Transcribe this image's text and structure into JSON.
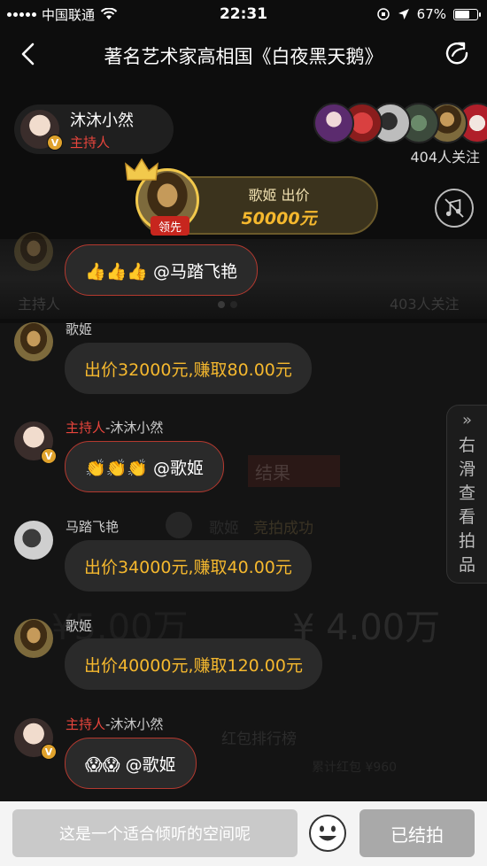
{
  "status_bar": {
    "carrier": "中国联通",
    "time": "22:31",
    "battery": "67%",
    "battery_level": 0.67
  },
  "nav": {
    "title": "著名艺术家高相国《白夜黑天鹅》"
  },
  "host": {
    "name": "沐沐小然",
    "role": "主持人"
  },
  "followers": {
    "count_text": "404人关注"
  },
  "lead_bid": {
    "label": "歌姬 出价",
    "amount": "50000元",
    "tag": "领先"
  },
  "background": {
    "chip_role": "主持人",
    "follow_text": "403人关注",
    "result_title": "结果",
    "winner": "歌姬",
    "winner_status": "竞拍成功",
    "price_left": "¥5.00万",
    "price_right": "¥ 4.00万",
    "ranking": "红包排行榜",
    "total_label": "累计红包 ¥960"
  },
  "messages": [
    {
      "sender": "",
      "role": "",
      "text": "👍👍👍 @马踏飞艳",
      "style": "white"
    },
    {
      "sender": "歌姬",
      "role": "",
      "text": "出价32000元,赚取80.00元",
      "style": "gold"
    },
    {
      "sender": "-沐沐小然",
      "role": "主持人",
      "text": "👏👏👏 @歌姬",
      "style": "host"
    },
    {
      "sender": "马踏飞艳",
      "role": "",
      "text": "出价34000元,赚取40.00元",
      "style": "gold"
    },
    {
      "sender": "歌姬",
      "role": "",
      "text": "出价40000元,赚取120.00元",
      "style": "gold"
    },
    {
      "sender": "-沐沐小然",
      "role": "主持人",
      "text": "😱😱 @歌姬",
      "style": "host"
    }
  ],
  "side_tab": {
    "chevron": "»",
    "label": "右滑查看拍品"
  },
  "bottom": {
    "input_placeholder": "这是一个适合倾听的空间呢",
    "ended_label": "已结拍"
  },
  "colors": {
    "gold": "#f5b82e",
    "host_red": "#e8453c",
    "lead_tag": "#c7261e"
  }
}
